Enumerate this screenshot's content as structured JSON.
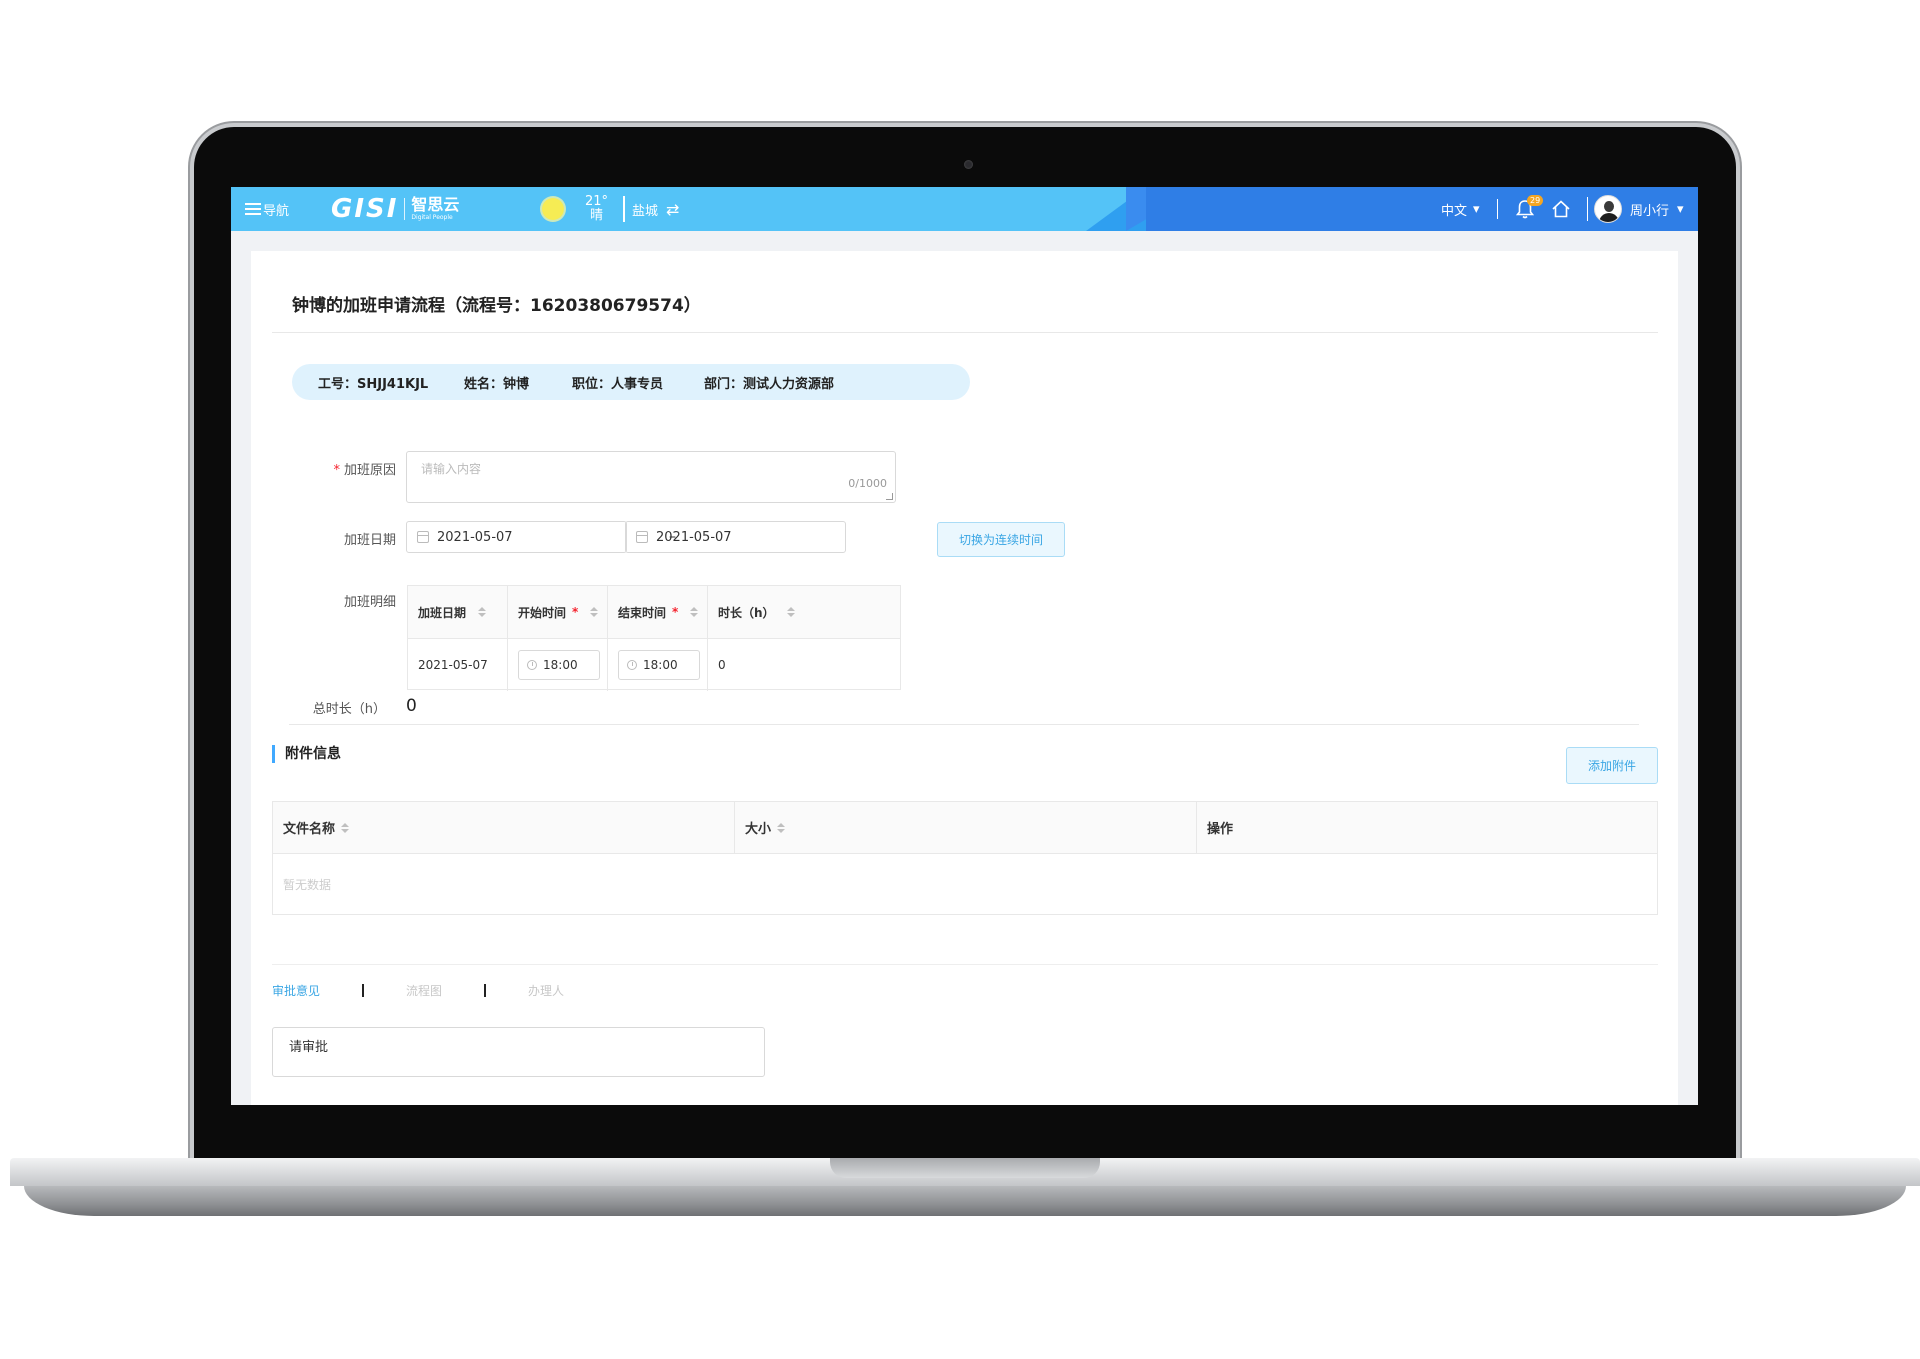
{
  "topbar": {
    "nav_label": "导航",
    "logo_text": "GISI",
    "logo_cn": "智思云",
    "logo_sub": "Digital People",
    "weather_temp": "21°",
    "weather_desc": "晴",
    "city": "盐城",
    "city_switch_icon": "⇄",
    "language": "中文",
    "notification_count": "29",
    "user_name": "周小行",
    "dropdown_caret": "▾"
  },
  "page": {
    "title": "钟博的加班申请流程（流程号：1620380679574）"
  },
  "employee": {
    "id": "工号：SHJJ41KJL",
    "name": "姓名：钟博",
    "position": "职位：人事专员",
    "department": "部门：测试人力资源部"
  },
  "form": {
    "reason_label": "加班原因",
    "reason_placeholder": "请输入内容",
    "reason_count": "0/1000",
    "date_label": "加班日期",
    "date_start": "2021-05-07",
    "date_separator": "–",
    "date_end": "2021-05-07",
    "switch_button": "切换为连续时间",
    "detail_label": "加班明细",
    "total_label": "总时长（h）",
    "total_value": "0"
  },
  "detail_table": {
    "headers": [
      "加班日期",
      "开始时间",
      "结束时间",
      "时长（h）"
    ],
    "rows": [
      {
        "date": "2021-05-07",
        "start": "18:00",
        "end": "18:00",
        "hours": "0"
      }
    ]
  },
  "attachments": {
    "section_title": "附件信息",
    "add_button": "添加附件",
    "headers": [
      "文件名称",
      "大小",
      "操作"
    ],
    "empty_text": "暂无数据"
  },
  "approval": {
    "tabs": [
      "审批意见",
      "流程图",
      "办理人"
    ],
    "active_tab": "审批意见",
    "comment_value": "请审批"
  },
  "colors": {
    "topbar": "#54c3f7",
    "topbar_dark": "#2f7ee6",
    "accent": "#3aa6e4",
    "required": "#f5222d",
    "pill_bg": "#dff2fd"
  }
}
